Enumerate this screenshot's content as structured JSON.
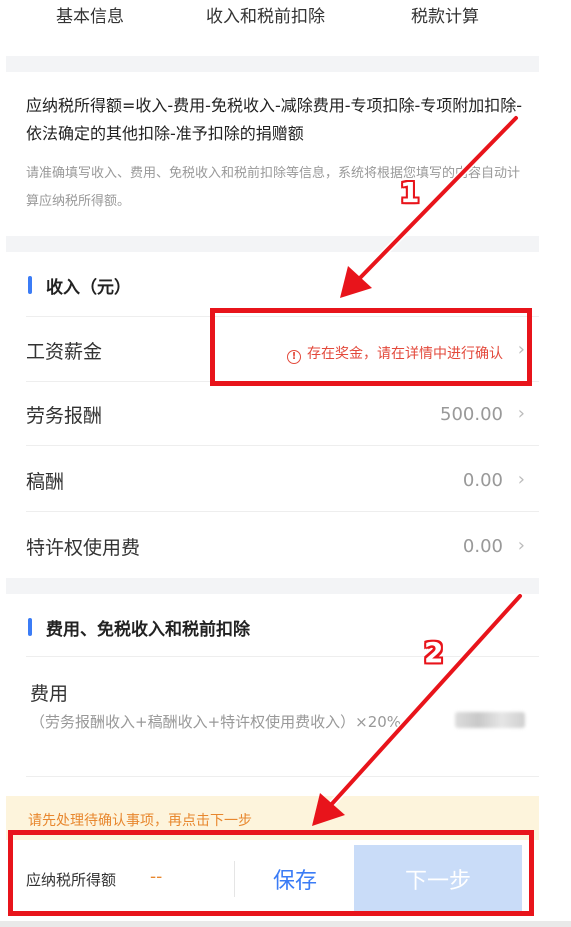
{
  "tabs": [
    "基本信息",
    "收入和税前扣除",
    "税款计算"
  ],
  "formula": "应纳税所得额=收入-费用-免税收入-减除费用-专项扣除-专项附加扣除-依法确定的其他扣除-准予扣除的捐赠额",
  "hint": "请准确填写收入、费用、免税收入和税前扣除等信息，系统将根据您填写的内容自动计算应纳税所得额。",
  "income_section": {
    "title": "收入（元）",
    "rows": [
      {
        "label": "工资薪金",
        "value": "存在奖金，请在详情中进行确认",
        "warning": true
      },
      {
        "label": "劳务报酬",
        "value": "500.00"
      },
      {
        "label": "稿酬",
        "value": "0.00"
      },
      {
        "label": "特许权使用费",
        "value": "0.00"
      }
    ]
  },
  "deduction_section": {
    "title": "费用、免税收入和税前扣除",
    "fee_label": "费用",
    "fee_desc": "（劳务报酬收入+稿酬收入+特许权使用费收入）×20%"
  },
  "notice": "请先处理待确认事项，再点击下一步",
  "footer": {
    "taxable_label": "应纳税所得额",
    "taxable_value": "--",
    "save_label": "保存",
    "next_label": "下一步"
  },
  "annotations": {
    "marker1": "1",
    "marker2": "2"
  },
  "colors": {
    "accent": "#3b7cf6",
    "warning": "#e34a3c",
    "notice_text": "#e8872e",
    "annotation": "#e8141b"
  }
}
